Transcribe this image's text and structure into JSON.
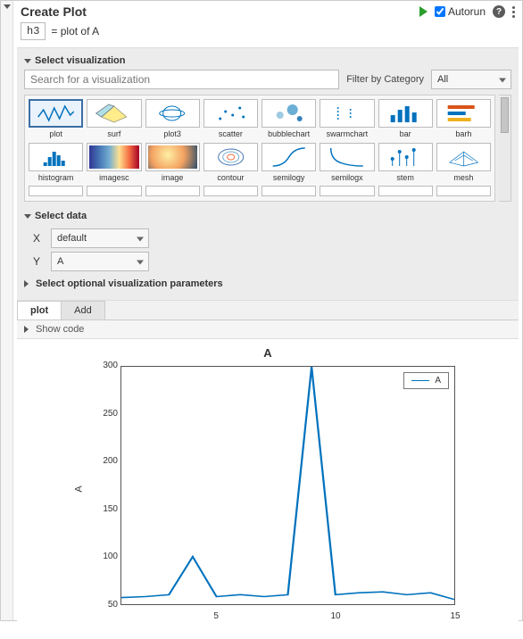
{
  "header": {
    "title": "Create Plot",
    "autorun_label": "Autorun",
    "autorun_checked": true
  },
  "assign": {
    "var": "h3",
    "rhs": "=  plot of A"
  },
  "sections": {
    "select_viz": "Select visualization",
    "select_data": "Select data",
    "select_opt": "Select optional visualization parameters",
    "show_code": "Show code"
  },
  "search": {
    "placeholder": "Search for a visualization",
    "filter_label": "Filter by Category",
    "filter_value": "All"
  },
  "viz_gallery": [
    {
      "name": "plot",
      "selected": true
    },
    {
      "name": "surf"
    },
    {
      "name": "plot3"
    },
    {
      "name": "scatter"
    },
    {
      "name": "bubblechart"
    },
    {
      "name": "swarmchart"
    },
    {
      "name": "bar"
    },
    {
      "name": "barh"
    },
    {
      "name": "histogram"
    },
    {
      "name": "imagesc"
    },
    {
      "name": "image"
    },
    {
      "name": "contour"
    },
    {
      "name": "semilogy"
    },
    {
      "name": "semilogx"
    },
    {
      "name": "stem"
    },
    {
      "name": "mesh"
    }
  ],
  "data_select": {
    "x_label": "X",
    "x_value": "default",
    "y_label": "Y",
    "y_value": "A"
  },
  "tabs": {
    "items": [
      "plot",
      "Add"
    ],
    "active": 0
  },
  "chart_data": {
    "type": "line",
    "title": "A",
    "ylabel": "A",
    "xlabel": "",
    "x": [
      1,
      2,
      3,
      4,
      5,
      6,
      7,
      8,
      9,
      10,
      11,
      12,
      13,
      14,
      15
    ],
    "series": [
      {
        "name": "A",
        "values": [
          57,
          58,
          60,
          100,
          58,
          60,
          58,
          60,
          300,
          60,
          62,
          63,
          60,
          62,
          55
        ]
      }
    ],
    "xlim": [
      1,
      15
    ],
    "ylim": [
      50,
      300
    ],
    "xticks": [
      5,
      10,
      15
    ],
    "yticks": [
      50,
      100,
      150,
      200,
      250,
      300
    ],
    "legend": [
      "A"
    ]
  },
  "colors": {
    "line": "#0072BD"
  }
}
